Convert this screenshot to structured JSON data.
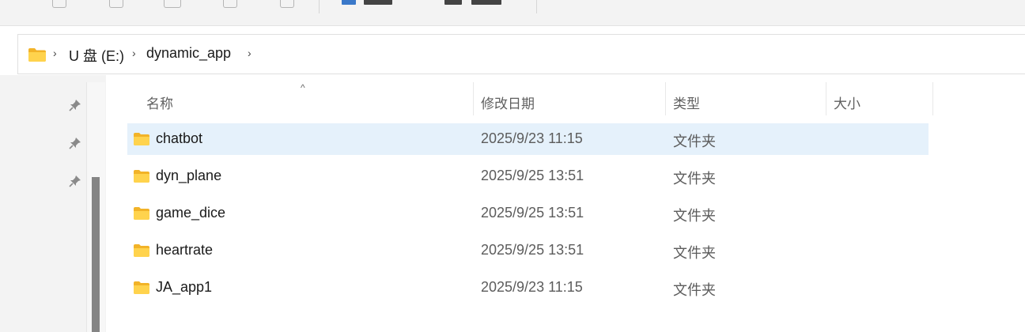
{
  "address_bar": {
    "crumbs": [
      "U 盘 (E:)",
      "dynamic_app"
    ],
    "icon": "folder-icon"
  },
  "quick_access": {
    "pins": [
      "pin-icon",
      "pin-icon",
      "pin-icon"
    ]
  },
  "file_list": {
    "columns": [
      "名称",
      "修改日期",
      "类型",
      "大小"
    ],
    "sort_indicator": "^",
    "rows": [
      {
        "name": "chatbot",
        "modified": "2025/9/23 11:15",
        "type": "文件夹",
        "size": ""
      },
      {
        "name": "dyn_plane",
        "modified": "2025/9/25 13:51",
        "type": "文件夹",
        "size": ""
      },
      {
        "name": "game_dice",
        "modified": "2025/9/25 13:51",
        "type": "文件夹",
        "size": ""
      },
      {
        "name": "heartrate",
        "modified": "2025/9/25 13:51",
        "type": "文件夹",
        "size": ""
      },
      {
        "name": "JA_app1",
        "modified": "2025/9/23 11:15",
        "type": "文件夹",
        "size": ""
      }
    ],
    "selected_index": 0
  },
  "colors": {
    "folder": "#ffcb3d",
    "selection": "#e5f1fb",
    "scroll_thumb": "#858585"
  }
}
